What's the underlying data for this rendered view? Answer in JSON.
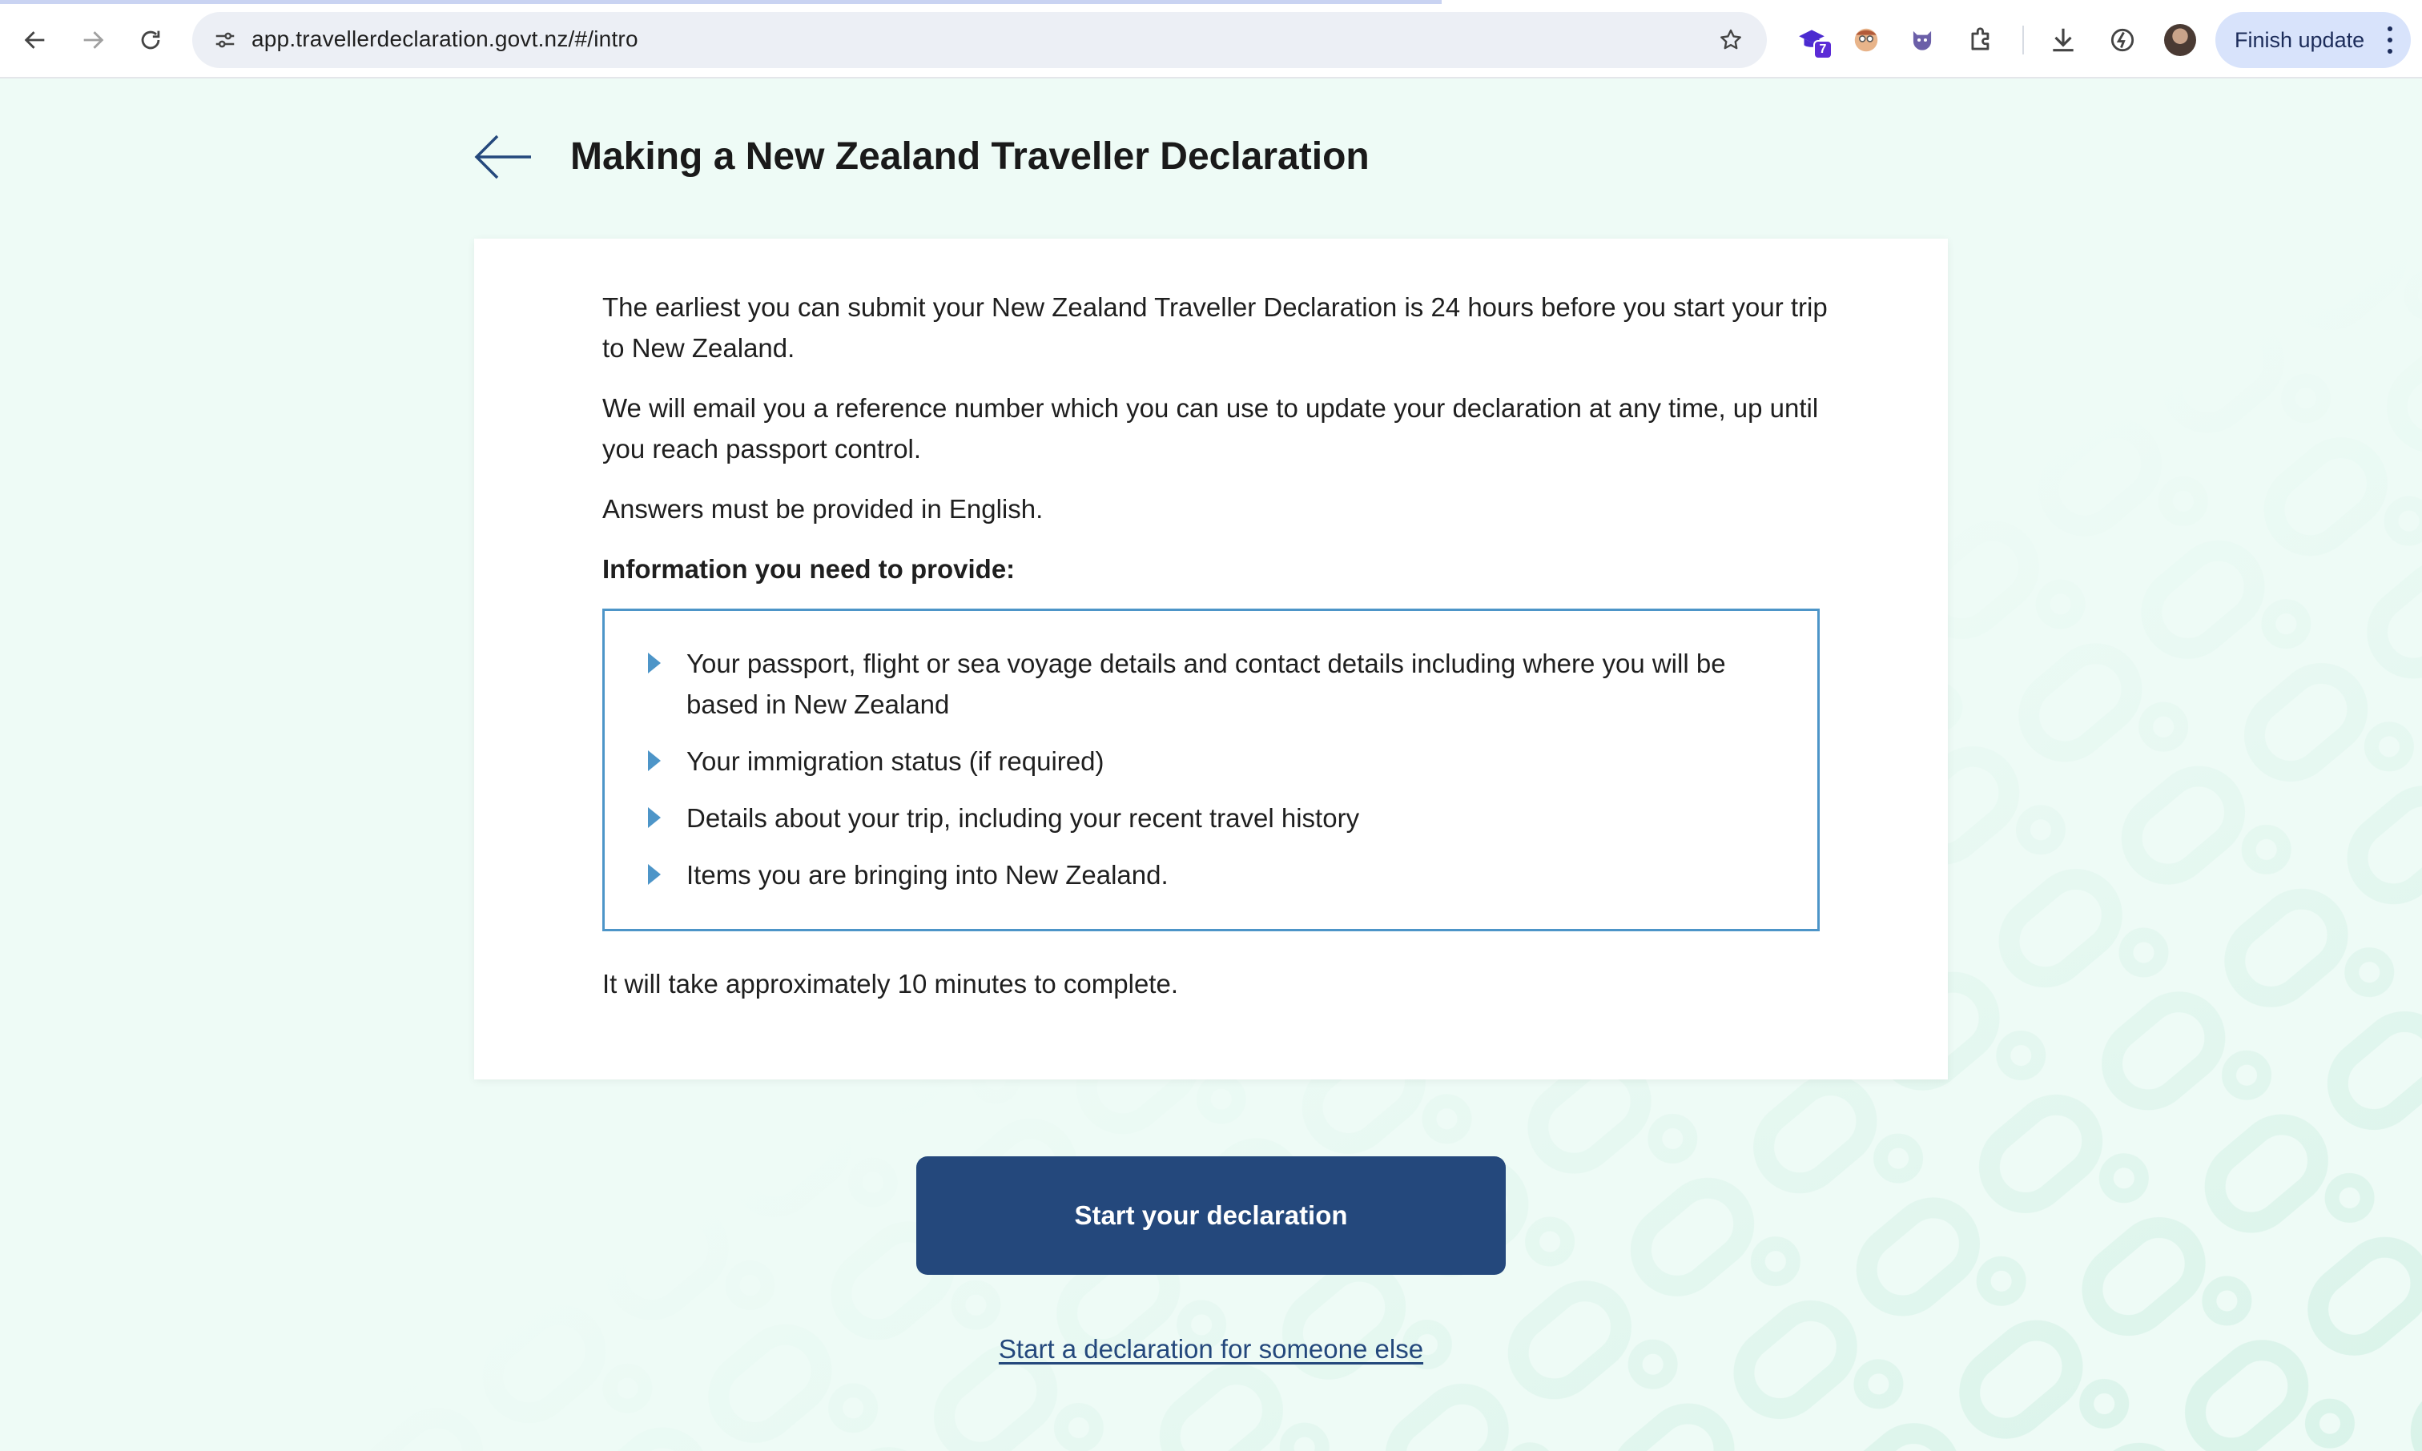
{
  "browser": {
    "url": "app.travellerdeclaration.govt.nz/#/intro",
    "extension_badge": "7",
    "finish_update_label": "Finish update",
    "icons": [
      "back-icon",
      "forward-icon",
      "reload-icon",
      "site-info-icon",
      "star-icon",
      "extension-icon",
      "puzzle-icon",
      "download-icon",
      "performance-icon",
      "profile-avatar",
      "more-icon"
    ]
  },
  "page": {
    "title": "Making a New Zealand Traveller Declaration",
    "paragraphs": [
      "The earliest you can submit your New Zealand Traveller Declaration is 24 hours before you start your trip to New Zealand.",
      "We will email you a reference number which you can use to update your declaration at any time, up until you reach passport control.",
      "Answers must be provided in English."
    ],
    "info_heading": "Information you need to provide:",
    "info_items": [
      "Your passport, flight or sea voyage details and contact details including where you will be based in New Zealand",
      "Your immigration status (if required)",
      "Details about your trip, including your recent travel history",
      "Items you are bringing into New Zealand."
    ],
    "duration_text": "It will take approximately 10 minutes to complete.",
    "start_button_label": "Start your declaration",
    "someone_else_link": "Start a declaration for someone else"
  },
  "colors": {
    "page_background": "#eefbf6",
    "primary_button": "#24487c",
    "info_border": "#4d95c8",
    "link": "#24487c"
  }
}
